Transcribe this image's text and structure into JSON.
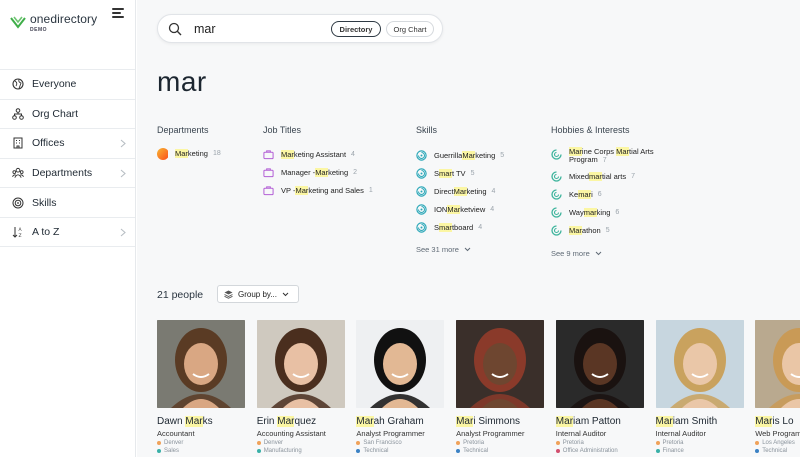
{
  "brand": {
    "name": "onedirectory",
    "sub": "DEMO"
  },
  "nav": [
    {
      "label": "Everyone",
      "icon": "globe-icon",
      "chevron": false
    },
    {
      "label": "Org Chart",
      "icon": "org-chart-icon",
      "chevron": false
    },
    {
      "label": "Offices",
      "icon": "building-icon",
      "chevron": true
    },
    {
      "label": "Departments",
      "icon": "departments-icon",
      "chevron": true
    },
    {
      "label": "Skills",
      "icon": "target-icon",
      "chevron": false
    },
    {
      "label": "A to Z",
      "icon": "sort-az-icon",
      "chevron": true
    }
  ],
  "search": {
    "value": "mar",
    "directory_label": "Directory",
    "org_chart_label": "Org Chart"
  },
  "query_heading": "mar",
  "sections": {
    "departments": {
      "title": "Departments",
      "items": [
        {
          "pre": "",
          "hl": "Mar",
          "post": "keting",
          "count": "18"
        }
      ]
    },
    "job_titles": {
      "title": "Job Titles",
      "items": [
        {
          "pre": "",
          "hl": "Mar",
          "post": "keting Assistant",
          "count": "4"
        },
        {
          "pre": "Manager - ",
          "hl": "Mar",
          "post": "keting",
          "count": "2"
        },
        {
          "pre": "VP - ",
          "hl": "Mar",
          "post": "keting and Sales",
          "count": "1"
        }
      ]
    },
    "skills": {
      "title": "Skills",
      "more": "See 31 more",
      "items": [
        {
          "pre": "Guerrilla ",
          "hl": "Mar",
          "post": "keting",
          "count": "5"
        },
        {
          "pre": "S",
          "hl": "mar",
          "post": "t TV",
          "count": "5"
        },
        {
          "pre": "Direct ",
          "hl": "Mar",
          "post": "keting",
          "count": "4"
        },
        {
          "pre": "ION ",
          "hl": "Mar",
          "post": "ketview",
          "count": "4"
        },
        {
          "pre": "S",
          "hl": "mar",
          "post": "tboard",
          "count": "4"
        }
      ]
    },
    "hobbies": {
      "title": "Hobbies & Interests",
      "more": "See 9 more",
      "items": [
        {
          "line1_hl": "Mar",
          "line1_post": "ine Corps ",
          "line1_hl2": "Mar",
          "line1_post2": "tial Arts",
          "line2": "Program",
          "count": "7"
        },
        {
          "pre": "Mixed ",
          "hl": "mar",
          "post": "tial arts",
          "count": "7"
        },
        {
          "pre": "Ke",
          "hl": "mar",
          "post": "i",
          "count": "6"
        },
        {
          "pre": "Way",
          "hl": "mar",
          "post": "king",
          "count": "6"
        },
        {
          "pre": "",
          "hl": "Mar",
          "post": "athon",
          "count": "5"
        }
      ]
    }
  },
  "people_count": "21 people",
  "group_by_label": "Group by...",
  "people": [
    {
      "pre": "Dawn ",
      "hl": "Mar",
      "post": "ks",
      "title": "Accountant",
      "office": "Denver",
      "dept": "Sales",
      "skin": "#d9a783",
      "hair": "#5a3b24",
      "bg": "#7a7a72",
      "dept_color": "#3ab0a8"
    },
    {
      "pre": "Erin ",
      "hl": "Mar",
      "post": "quez",
      "title": "Accounting Assistant",
      "office": "Denver",
      "dept": "Manufacturing",
      "skin": "#e8c0a4",
      "hair": "#4a2e1e",
      "bg": "#cfc9bf",
      "dept_color": "#3ab0a8"
    },
    {
      "pre": "",
      "hl": "Mar",
      "post": "ah Graham",
      "title": "Analyst Programmer",
      "office": "San Francisco",
      "dept": "Technical",
      "skin": "#e2b894",
      "hair": "#111111",
      "bg": "#eef0f2",
      "dept_color": "#3b82c4"
    },
    {
      "pre": "",
      "hl": "Mar",
      "post": "i Simmons",
      "title": "Analyst Programmer",
      "office": "Pretoria",
      "dept": "Technical",
      "skin": "#6e4630",
      "hair": "#8a3a2a",
      "bg": "#3a2f2a",
      "dept_color": "#3b82c4"
    },
    {
      "pre": "",
      "hl": "Mar",
      "post": "iam Patton",
      "title": "Internal Auditor",
      "office": "Pretoria",
      "dept": "Office Administration",
      "skin": "#5a3624",
      "hair": "#1a1210",
      "bg": "#2a2a2a",
      "dept_color": "#d24f6e"
    },
    {
      "pre": "",
      "hl": "Mar",
      "post": "iam Smith",
      "title": "Internal Auditor",
      "office": "Pretoria",
      "dept": "Finance",
      "skin": "#eac7a8",
      "hair": "#c9a25e",
      "bg": "#c7d6df",
      "dept_color": "#3ab0a8"
    },
    {
      "pre": "",
      "hl": "Mar",
      "post": "is Lo",
      "title": "Web Program",
      "office": "Los Angeles",
      "dept": "Technical",
      "skin": "#eac6a6",
      "hair": "#c99a56",
      "bg": "#b9a98f",
      "dept_color": "#3b82c4"
    }
  ],
  "colors": {
    "highlight": "#fbf6a3",
    "brand_green": "#3fae49",
    "skill_teal": "#2aa7b8",
    "hobby_teal": "#3bb39b",
    "job_purple": "#b35fd6"
  }
}
